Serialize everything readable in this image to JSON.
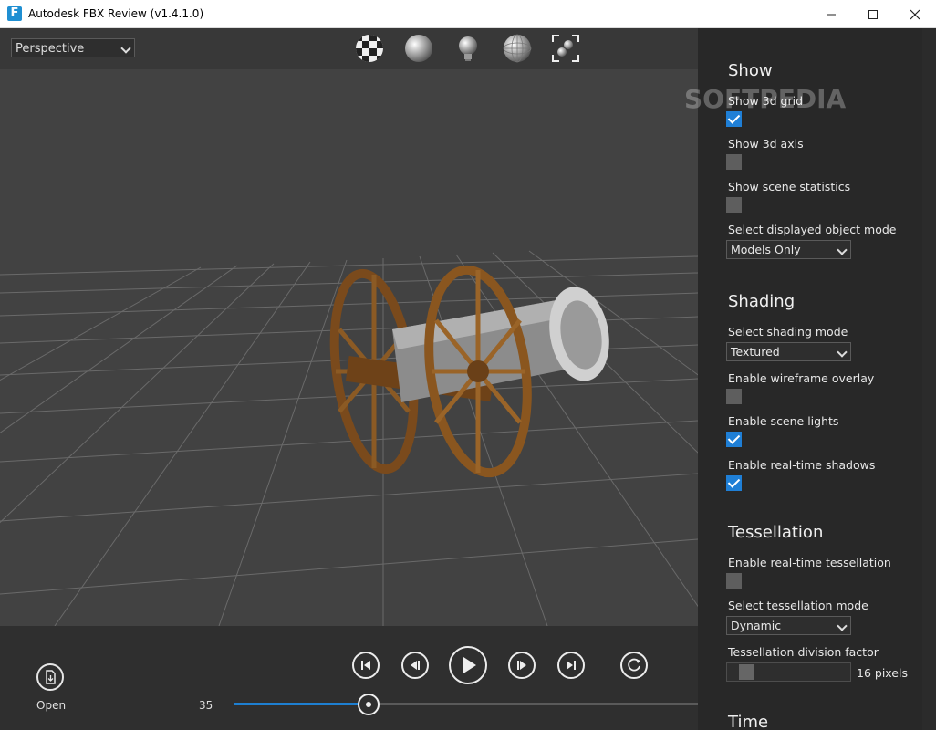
{
  "window": {
    "title": "Autodesk FBX Review (v1.4.1.0)",
    "icon_letter": "F"
  },
  "viewport": {
    "camera_view": "Perspective"
  },
  "toolbar": {
    "icons": [
      "checker-sphere-icon",
      "sphere-icon",
      "light-bulb-icon",
      "wireframe-sphere-icon",
      "frame-all-icon"
    ]
  },
  "playback": {
    "open_label": "Open",
    "current_frame": "35",
    "progress": 0.29
  },
  "panel": {
    "show": {
      "title": "Show",
      "show_grid": {
        "label": "Show 3d grid",
        "checked": true
      },
      "show_axis": {
        "label": "Show 3d axis",
        "checked": false
      },
      "show_stats": {
        "label": "Show scene statistics",
        "checked": false
      },
      "object_mode": {
        "label": "Select displayed object mode",
        "value": "Models Only"
      }
    },
    "shading": {
      "title": "Shading",
      "mode": {
        "label": "Select shading mode",
        "value": "Textured"
      },
      "wireframe": {
        "label": "Enable wireframe overlay",
        "checked": false
      },
      "lights": {
        "label": "Enable scene lights",
        "checked": true
      },
      "shadows": {
        "label": "Enable real-time shadows",
        "checked": true
      }
    },
    "tessellation": {
      "title": "Tessellation",
      "enable": {
        "label": "Enable real-time tessellation",
        "checked": false
      },
      "mode": {
        "label": "Select tessellation mode",
        "value": "Dynamic"
      },
      "factor": {
        "label": "Tessellation division factor",
        "value": "16 pixels"
      }
    },
    "time": {
      "title": "Time"
    }
  },
  "watermark": "SOFTPEDIA",
  "colors": {
    "accent": "#1f7fd6",
    "panel_bg": "#282828",
    "viewport_bg": "#3d3d3d"
  }
}
